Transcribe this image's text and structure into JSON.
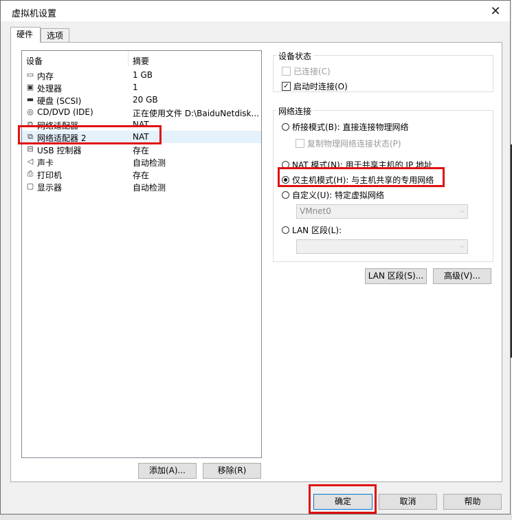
{
  "window": {
    "title": "虚拟机设置",
    "close_glyph": "✕"
  },
  "tabs": [
    {
      "label": "硬件"
    },
    {
      "label": "选项"
    }
  ],
  "device_list": {
    "headers": {
      "device": "设备",
      "summary": "摘要"
    },
    "rows": [
      {
        "icon": "memory-icon",
        "name": "内存",
        "summary": "1 GB"
      },
      {
        "icon": "processor-icon",
        "name": "处理器",
        "summary": "1"
      },
      {
        "icon": "hard-disk-icon",
        "name": "硬盘 (SCSI)",
        "summary": "20 GB"
      },
      {
        "icon": "cd-dvd-icon",
        "name": "CD/DVD (IDE)",
        "summary": "正在使用文件 D:\\BaiduNetdisk..."
      },
      {
        "icon": "network-adapter-icon",
        "name": "网络适配器",
        "summary": "NAT"
      },
      {
        "icon": "network-adapter-icon",
        "name": "网络适配器 2",
        "summary": "NAT"
      },
      {
        "icon": "usb-controller-icon",
        "name": "USB 控制器",
        "summary": "存在"
      },
      {
        "icon": "sound-card-icon",
        "name": "声卡",
        "summary": "自动检测"
      },
      {
        "icon": "printer-icon",
        "name": "打印机",
        "summary": "存在"
      },
      {
        "icon": "display-icon",
        "name": "显示器",
        "summary": "自动检测"
      }
    ]
  },
  "device_buttons": {
    "add": "添加(A)...",
    "remove": "移除(R)"
  },
  "device_status": {
    "title": "设备状态",
    "connected": {
      "label": "已连接(C)",
      "checked": false,
      "enabled": false
    },
    "connect_at_power_on": {
      "label": "启动时连接(O)",
      "checked": true,
      "enabled": true
    }
  },
  "network_connection": {
    "title": "网络连接",
    "bridged": {
      "label": "桥接模式(B): 直接连接物理网络",
      "selected": false
    },
    "replicate": {
      "label": "复制物理网络连接状态(P)",
      "checked": false
    },
    "nat": {
      "label": "NAT 模式(N): 用于共享主机的 IP 地址",
      "selected": false
    },
    "host_only": {
      "label": "仅主机模式(H): 与主机共享的专用网络",
      "selected": true
    },
    "custom": {
      "label": "自定义(U): 特定虚拟网络",
      "selected": false,
      "value": "VMnet0"
    },
    "lan_segment": {
      "label": "LAN 区段(L):",
      "selected": false,
      "value": ""
    }
  },
  "network_buttons": {
    "lan_segments": "LAN 区段(S)...",
    "advanced": "高级(V)..."
  },
  "footer": {
    "ok": "确定",
    "cancel": "取消",
    "help": "帮助"
  },
  "colors": {
    "highlight": "#e01010",
    "selection": "#e5f1fb",
    "accent": "#0078d7"
  },
  "icon_glyphs": {
    "memory-icon": "▭",
    "processor-icon": "▣",
    "hard-disk-icon": "▬",
    "cd-dvd-icon": "◎",
    "network-adapter-icon": "⧉",
    "usb-controller-icon": "⊟",
    "sound-card-icon": "◁",
    "printer-icon": "⎙",
    "display-icon": "▢"
  }
}
